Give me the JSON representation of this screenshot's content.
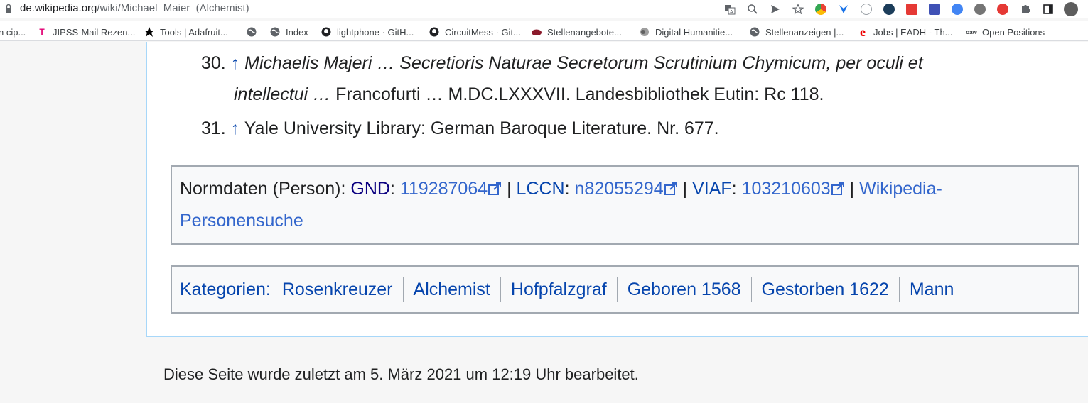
{
  "browser": {
    "url_host": "de.wikipedia.org",
    "url_path": "/wiki/Michael_Maier_(Alchemist)"
  },
  "bookmarks": [
    {
      "label": "n cip...",
      "icon": "bookmark-icon"
    },
    {
      "label": "JIPSS-Mail Rezen...",
      "icon": "telekom-icon"
    },
    {
      "label": "Tools | Adafruit...",
      "icon": "adafruit-icon"
    },
    {
      "label": "",
      "icon": "globe-icon"
    },
    {
      "label": "Index",
      "icon": "globe-icon"
    },
    {
      "label": "lightphone · GitH...",
      "icon": "github-icon"
    },
    {
      "label": "CircuitMess · Git...",
      "icon": "github-icon"
    },
    {
      "label": "Stellenangebote...",
      "icon": "stellen-icon"
    },
    {
      "label": "Digital Humanitie...",
      "icon": "dh-icon"
    },
    {
      "label": "Stellenanzeigen |...",
      "icon": "globe-icon"
    },
    {
      "label": "Jobs | EADH - Th...",
      "icon": "eadh-icon"
    },
    {
      "label": "Open Positions",
      "icon": "oaw-icon"
    }
  ],
  "references": {
    "ref30": {
      "number": "30.",
      "arrow": "↑",
      "italic_part1": "Michaelis Majeri … Secretioris Naturae Secretorum Scrutinium Chymicum, per oculi et",
      "italic_part2": "intellectui …",
      "plain": "Francofurti … M.DC.LXXXVII. Landesbibliothek Eutin: Rc 118."
    },
    "ref31": {
      "number": "31.",
      "arrow": "↑",
      "text": "Yale University Library: German Baroque Literature. Nr. 677."
    }
  },
  "normdaten": {
    "prefix": "Normdaten (Person):",
    "gnd_label": "GND",
    "gnd_value": "119287064",
    "lccn_label": "LCCN",
    "lccn_value": "n82055294",
    "viaf_label": "VIAF",
    "viaf_value": "103210603",
    "separator": "|",
    "personensuche_1": "Wikipedia-",
    "personensuche_2": "Personensuche"
  },
  "categories": {
    "label": "Kategorien:",
    "items": [
      "Rosenkreuzer",
      "Alchemist",
      "Hofpfalzgraf",
      "Geboren 1568",
      "Gestorben 1622",
      "Mann"
    ]
  },
  "footer": {
    "last_edited": "Diese Seite wurde zuletzt am 5. März 2021 um 12:19 Uhr bearbeitet."
  }
}
